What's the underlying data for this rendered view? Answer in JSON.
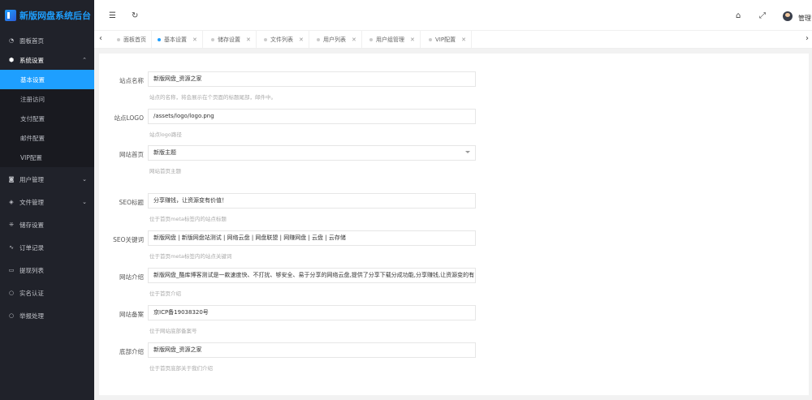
{
  "sidebar": {
    "logo_text": "新版网盘系统后台",
    "items": [
      {
        "label": "面板首页"
      },
      {
        "label": "系统设置"
      },
      {
        "label": "用户管理"
      },
      {
        "label": "文件管理"
      },
      {
        "label": "储存设置"
      },
      {
        "label": "订单记录"
      },
      {
        "label": "提现列表"
      },
      {
        "label": "实名认证"
      },
      {
        "label": "举报处理"
      }
    ],
    "sub_items": [
      {
        "label": "基本设置"
      },
      {
        "label": "注册访问"
      },
      {
        "label": "支付配置"
      },
      {
        "label": "邮件配置"
      },
      {
        "label": "VIP配置"
      }
    ]
  },
  "header": {
    "user_name": "管理"
  },
  "tabs": [
    {
      "label": "面板首页"
    },
    {
      "label": "基本设置"
    },
    {
      "label": "储存设置"
    },
    {
      "label": "文件列表"
    },
    {
      "label": "用户列表"
    },
    {
      "label": "用户组管理"
    },
    {
      "label": "VIP配置"
    }
  ],
  "form": [
    {
      "label": "站点名称",
      "value": "新版网盘_资源之家",
      "help": "站点的名称，将会展示在个页面的标题尾部，邮件中。"
    },
    {
      "label": "站点LOGO",
      "value": "/assets/logo/logo.png",
      "help": "站点logo路径"
    },
    {
      "label": "网站首页",
      "value": "新版主题",
      "help": "网站首页主题"
    },
    {
      "label": "SEO标题",
      "value": "分享赚钱，让资源变有价值！",
      "help": "位于首页meta标签内的站点标题"
    },
    {
      "label": "SEO关键词",
      "value": "新版网盘 | 新版网盘站测试 | 网络云盘 | 网盘联盟 | 网赚网盘 | 云盘 | 云存储",
      "help": "位于首页meta标签内的站点关键词"
    },
    {
      "label": "网站介绍",
      "value": "新版网盘_酷库博客测试是一款速度快、不打扰、够安全、易于分享的网络云盘,提供了分享下载分成功能,分享赚钱,让资源变的有",
      "help": "位于首页介绍"
    },
    {
      "label": "网站备案",
      "value": "京ICP备19038320号",
      "help": "位于网站底部备案号"
    },
    {
      "label": "底部介绍",
      "value": "新版网盘_资源之家",
      "help": "位于首页底部关于我们介绍"
    }
  ]
}
